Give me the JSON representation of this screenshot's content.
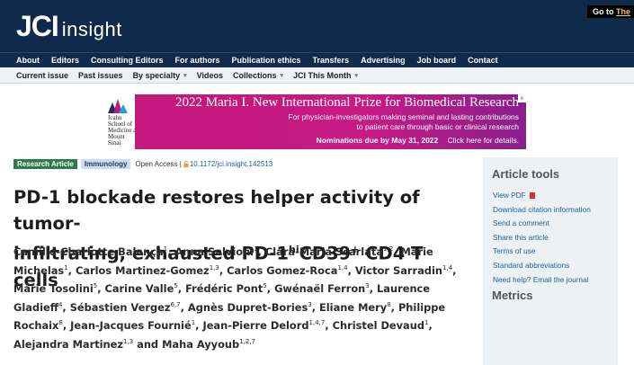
{
  "header": {
    "logo_main": "JCI",
    "logo_sub": "insight",
    "goto_prefix": "Go to",
    "goto_link": "The"
  },
  "nav": {
    "items": [
      "About",
      "Editors",
      "Consulting Editors",
      "For authors",
      "Publication ethics",
      "Transfers",
      "Advertising",
      "Job board",
      "Contact"
    ]
  },
  "subnav": {
    "items": [
      {
        "label": "Current issue",
        "dropdown": false
      },
      {
        "label": "Past issues",
        "dropdown": false
      },
      {
        "label": "By specialty",
        "dropdown": true
      },
      {
        "label": "Videos",
        "dropdown": false
      },
      {
        "label": "Collections",
        "dropdown": true
      },
      {
        "label": "JCI This Month",
        "dropdown": true
      }
    ]
  },
  "ad": {
    "logo_text": [
      "Icahn",
      "School of",
      "Medicine at",
      "Mount",
      "Sinai"
    ],
    "title": "2022 Maria I. New International Prize for Biomedical Research",
    "line1": "For physician-investigators making seminal and lasting contributions",
    "line2": "to patient care through basic or clinical research",
    "nominations": "Nominations due by May 31, 2022",
    "cta": "Click here for details.",
    "close": "×"
  },
  "article": {
    "type_badge": "Research Article",
    "category_badge": "Immunology",
    "open_access": "Open Access |",
    "doi": "10.1172/jci.insight.142513",
    "title_line1": "PD-1 blockade restores helper activity of tumor-",
    "title_line2_a": "infiltrating, exhausted PD-1",
    "title_sup1": "hi",
    "title_line2_b": "CD39",
    "title_sup2": "+",
    "title_line2_c": " CD4 T cells",
    "authors": [
      {
        "name": "Camille-Charlotte Balança",
        "aff": "1"
      },
      {
        "name": "Anna Salvioni",
        "aff": "1"
      },
      {
        "name": "Clara-Maria Scarlata",
        "aff": "1,2"
      },
      {
        "name": "Marie Michelas",
        "aff": "1"
      },
      {
        "name": "Carlos Martinez-Gomez",
        "aff": "1,3"
      },
      {
        "name": "Carlos Gomez-Roca",
        "aff": "1,4"
      },
      {
        "name": "Victor Sarradin",
        "aff": "1,4"
      },
      {
        "name": "Marie Tosolini",
        "aff": "5"
      },
      {
        "name": "Carine Valle",
        "aff": "5"
      },
      {
        "name": "Frédéric Pont",
        "aff": "5"
      },
      {
        "name": "Gwénaël Ferron",
        "aff": "3"
      },
      {
        "name": "Laurence Gladieff",
        "aff": "4"
      },
      {
        "name": "Sébastien Vergez",
        "aff": "6,7"
      },
      {
        "name": "Agnès Dupret-Bories",
        "aff": "3"
      },
      {
        "name": "Eliane Mery",
        "aff": "8"
      },
      {
        "name": "Philippe Rochaix",
        "aff": "8"
      },
      {
        "name": "Jean-Jacques Fournié",
        "aff": "1"
      },
      {
        "name": "Jean-Pierre Delord",
        "aff": "1,4,7"
      },
      {
        "name": "Christel Devaud",
        "aff": "1"
      },
      {
        "name": "Alejandra Martinez",
        "aff": "1,3"
      },
      {
        "name": "Maha Ayyoub",
        "aff": "1,2,7"
      }
    ],
    "and_word": "and"
  },
  "sidebar": {
    "tools_title": "Article tools",
    "links": [
      "View PDF",
      "Download citation information",
      "Send a comment",
      "Share this article",
      "Terms of use",
      "Standard abbreviations",
      "Need help? Email the journal"
    ],
    "metrics_title": "Metrics"
  },
  "colors": {
    "header_bg": "#0f2a4a",
    "ad_magenta": "#c61a85",
    "badge_green": "#2e7a4a",
    "badge_blue": "#c9dff1",
    "link_blue": "#1a5fa6"
  }
}
